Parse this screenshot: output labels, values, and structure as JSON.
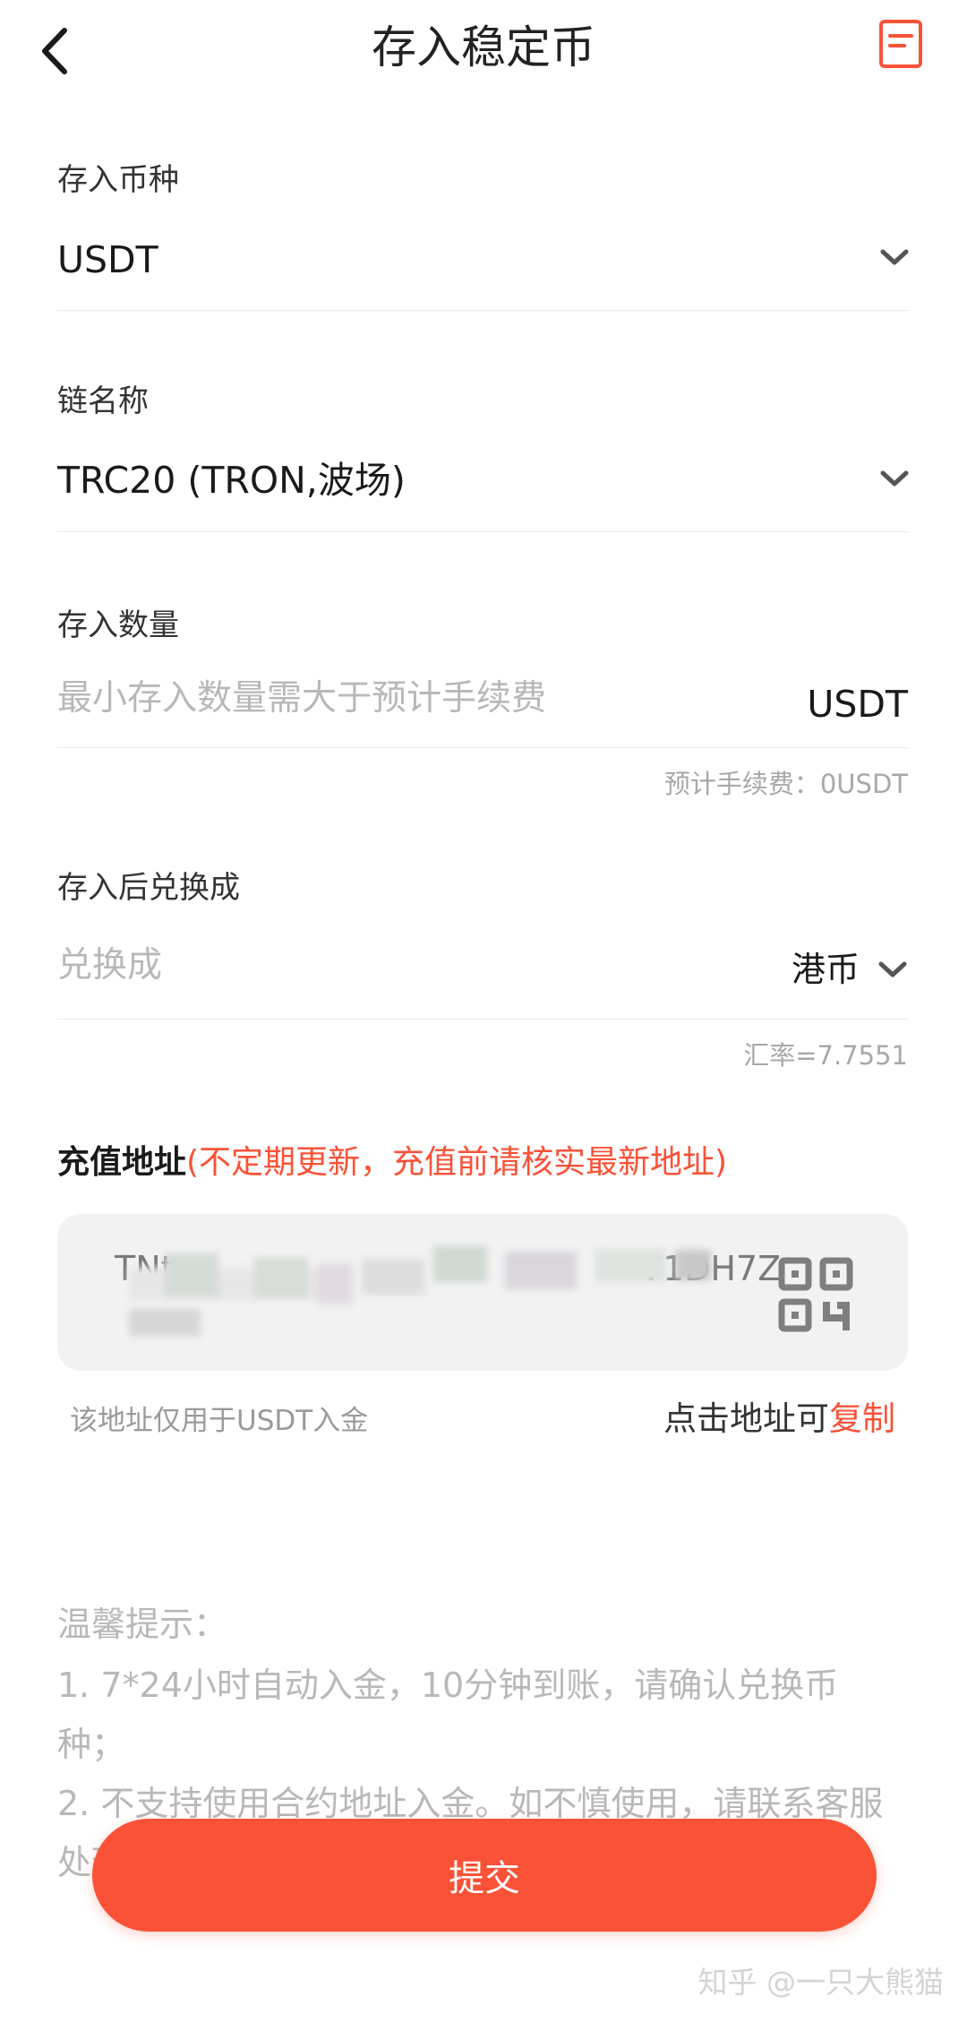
{
  "colors": {
    "accent": "#fa5237",
    "divider": "#ececec",
    "address_bg": "#f2f2f2",
    "muted": "#b8b8b8"
  },
  "header": {
    "title": "存入稳定币",
    "back_icon": "chevron-left-icon",
    "record_icon": "document-list-icon"
  },
  "coin": {
    "label": "存入币种",
    "value": "USDT"
  },
  "chain": {
    "label": "链名称",
    "value": "TRC20 (TRON,波场)"
  },
  "amount": {
    "label": "存入数量",
    "placeholder": "最小存入数量需大于预计手续费",
    "unit": "USDT",
    "fee": "预计手续费：0USDT"
  },
  "convert": {
    "label": "存入后兑换成",
    "placeholder": "兑换成",
    "currency": "港币",
    "rate": "汇率=7.7551"
  },
  "address": {
    "label": "充值地址",
    "warning": "(不定期更新，充值前请核实最新地址)",
    "prefix_visible": "TNt",
    "suffix_visible": "V1DH7Z",
    "qr_icon": "qr-code-icon",
    "usage_note": "该地址仅用于USDT入金",
    "copy_hint": "点击地址可",
    "copy_action": "复制"
  },
  "tips": {
    "title": "温馨提示：",
    "line1": "1. 7*24小时自动入金，10分钟到账，请确认兑换币",
    "line1b": "种；",
    "line2": "2. 不支持使用合约地址入金。如不慎使用，请联系客服",
    "line2b": "处理"
  },
  "submit": {
    "label": "提交"
  },
  "watermark": "知乎 @一只大熊猫"
}
